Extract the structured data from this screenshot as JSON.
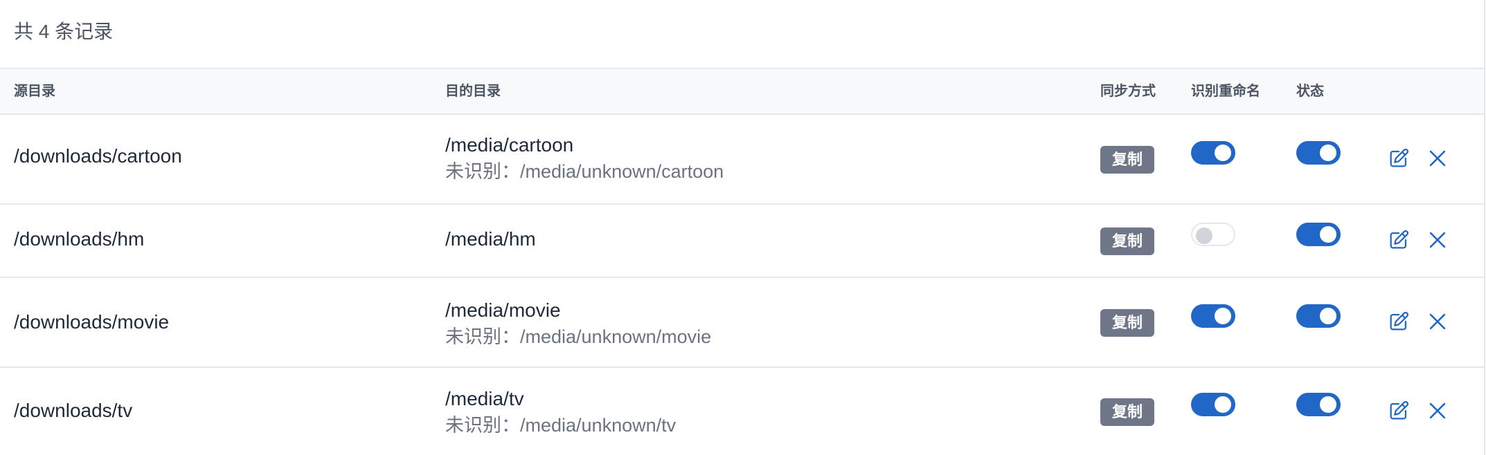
{
  "record_count": "共 4 条记录",
  "table": {
    "headers": {
      "source": "源目录",
      "target": "目的目录",
      "sync_mode": "同步方式",
      "rename": "识别重命名",
      "status": "状态"
    },
    "rows": [
      {
        "source": "/downloads/cartoon",
        "target": "/media/cartoon",
        "unknown": "未识别：/media/unknown/cartoon",
        "mode": "复制",
        "rename_on": true,
        "status_on": true
      },
      {
        "source": "/downloads/hm",
        "target": "/media/hm",
        "unknown": "",
        "mode": "复制",
        "rename_on": false,
        "status_on": true
      },
      {
        "source": "/downloads/movie",
        "target": "/media/movie",
        "unknown": "未识别：/media/unknown/movie",
        "mode": "复制",
        "rename_on": true,
        "status_on": true
      },
      {
        "source": "/downloads/tv",
        "target": "/media/tv",
        "unknown": "未识别：/media/unknown/tv",
        "mode": "复制",
        "rename_on": true,
        "status_on": true
      }
    ]
  },
  "icons": {
    "edit": "edit-icon",
    "delete": "close-icon"
  },
  "colors": {
    "accent": "#2067c7",
    "badge": "#6e7687",
    "header_bg": "#f8f9fb"
  }
}
